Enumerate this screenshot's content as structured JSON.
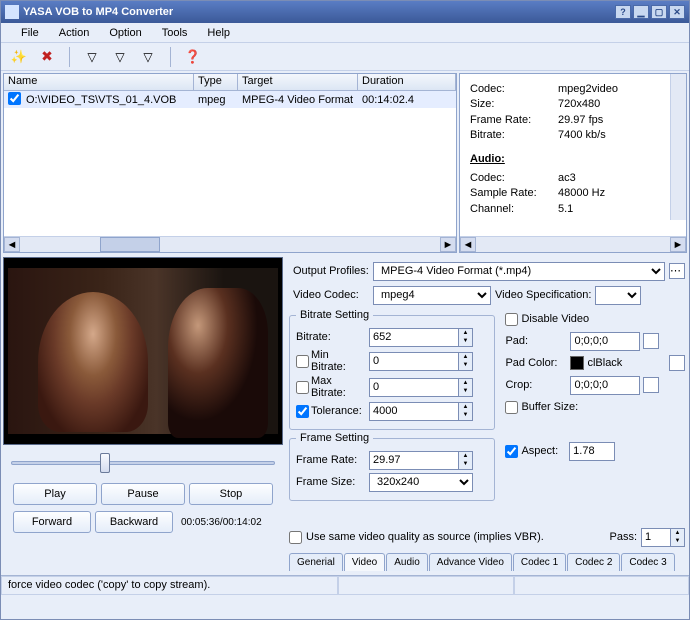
{
  "title": "YASA VOB to MP4 Converter",
  "menu": {
    "file": "File",
    "action": "Action",
    "option": "Option",
    "tools": "Tools",
    "help": "Help"
  },
  "list": {
    "headers": {
      "name": "Name",
      "type": "Type",
      "target": "Target",
      "duration": "Duration"
    },
    "row": {
      "name": "O:\\VIDEO_TS\\VTS_01_4.VOB",
      "type": "mpeg",
      "target": "MPEG-4 Video Format",
      "duration": "00:14:02.4"
    }
  },
  "info": {
    "codec": "mpeg2video",
    "size": "720x480",
    "framerate": "29.97 fps",
    "bitrate": "7400 kb/s",
    "audioHeader": "Audio:",
    "acodec": "ac3",
    "sampleRate": "48000 Hz",
    "channel": "5.1",
    "labels": {
      "codec": "Codec:",
      "size": "Size:",
      "framerate": "Frame Rate:",
      "bitrate": "Bitrate:",
      "acodec": "Codec:",
      "sampleRate": "Sample Rate:",
      "channel": "Channel:"
    }
  },
  "preview": {
    "play": "Play",
    "pause": "Pause",
    "stop": "Stop",
    "forward": "Forward",
    "backward": "Backward",
    "time": "00:05:36/00:14:02"
  },
  "settings": {
    "outputProfilesLabel": "Output Profiles:",
    "outputProfiles": "MPEG-4 Video Format (*.mp4)",
    "videoCodecLabel": "Video Codec:",
    "videoCodec": "mpeg4",
    "videoSpecLabel": "Video Specification:",
    "bitrateSetting": "Bitrate Setting",
    "bitrateLabel": "Bitrate:",
    "bitrate": "652",
    "minBitrateLabel": "Min Bitrate:",
    "minBitrate": "0",
    "maxBitrateLabel": "Max Bitrate:",
    "maxBitrate": "0",
    "toleranceLabel": "Tolerance:",
    "tolerance": "4000",
    "frameSetting": "Frame Setting",
    "frameRateLabel": "Frame Rate:",
    "frameRate": "29.97",
    "frameSizeLabel": "Frame Size:",
    "frameSize": "320x240",
    "disableVideo": "Disable Video",
    "padLabel": "Pad:",
    "pad": "0;0;0;0",
    "padColorLabel": "Pad Color:",
    "padColor": "clBlack",
    "cropLabel": "Crop:",
    "crop": "0;0;0;0",
    "bufferSizeLabel": "Buffer Size:",
    "aspectLabel": "Aspect:",
    "aspect": "1.78",
    "sameQuality": "Use same video quality as source (implies VBR).",
    "passLabel": "Pass:",
    "pass": "1",
    "tabs": {
      "general": "Generial",
      "video": "Video",
      "audio": "Audio",
      "advance": "Advance Video",
      "codec1": "Codec 1",
      "codec2": "Codec 2",
      "codec3": "Codec 3"
    }
  },
  "status": "force video codec ('copy' to copy stream)."
}
